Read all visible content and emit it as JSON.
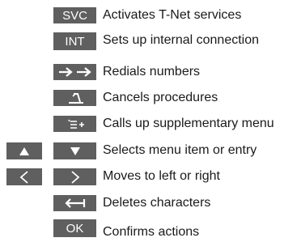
{
  "rows": [
    {
      "key": "SVC",
      "icon": "svc-key",
      "text": "Activates T-Net services"
    },
    {
      "key": "INT",
      "icon": "int-key",
      "text": "Sets up internal connection"
    },
    {
      "key": "",
      "icon": "redial-arrows-icon",
      "text": "Redials numbers"
    },
    {
      "key": "",
      "icon": "hang-up-icon",
      "text": "Cancels procedures"
    },
    {
      "key": "",
      "icon": "supplementary-menu-icon",
      "text": "Calls up supplementary menu"
    },
    {
      "key": "",
      "icon": "up-down-triangles-icon",
      "text": "Selects menu item or entry"
    },
    {
      "key": "",
      "icon": "left-right-chevrons-icon",
      "text": "Moves to left or right"
    },
    {
      "key": "",
      "icon": "backspace-arrow-icon",
      "text": "Deletes characters"
    },
    {
      "key": "OK",
      "icon": "ok-key",
      "text": "Confirms actions"
    }
  ],
  "colors": {
    "key_bg": "#5f5f5f",
    "key_fg": "#ffffff",
    "text": "#1a1a1a"
  }
}
